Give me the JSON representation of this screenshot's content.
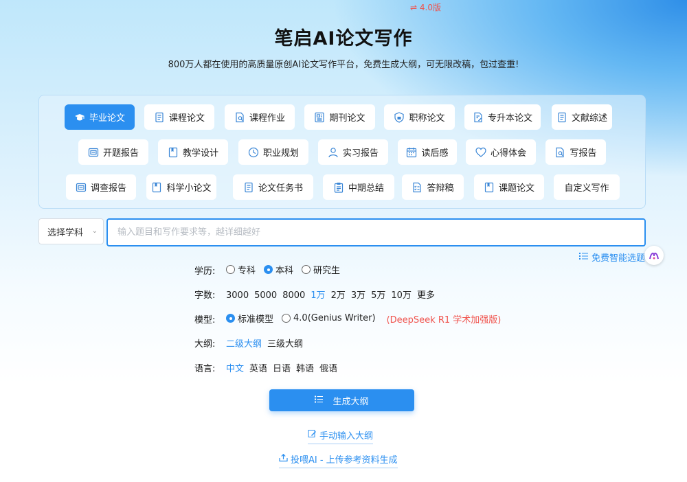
{
  "header": {
    "title": "笔启AI论文写作",
    "version": "⇌ 4.0版",
    "subtitle": "800万人都在使用的高质量原创AI论文写作平台，免费生成大纲，可无限改稿，包过查重!"
  },
  "paper_types": [
    {
      "label": "毕业论文",
      "icon": "graduation-cap-icon",
      "active": true
    },
    {
      "label": "课程论文",
      "icon": "document-icon"
    },
    {
      "label": "课程作业",
      "icon": "document-search-icon"
    },
    {
      "label": "期刊论文",
      "icon": "journal-icon"
    },
    {
      "label": "职称论文",
      "icon": "shield-badge-icon"
    },
    {
      "label": "专升本论文",
      "icon": "document-edit-icon"
    },
    {
      "label": "文献综述",
      "icon": "document-icon"
    },
    {
      "label": "开题报告",
      "icon": "report-icon"
    },
    {
      "label": "教学设计",
      "icon": "book-icon"
    },
    {
      "label": "职业规划",
      "icon": "clock-icon"
    },
    {
      "label": "实习报告",
      "icon": "person-icon"
    },
    {
      "label": "读后感",
      "icon": "calendar-icon"
    },
    {
      "label": "心得体会",
      "icon": "heart-icon"
    },
    {
      "label": "写报告",
      "icon": "document-search-icon"
    },
    {
      "label": "调查报告",
      "icon": "report-icon"
    },
    {
      "label": "科学小论文",
      "icon": "book-icon"
    },
    {
      "label": "论文任务书",
      "icon": "document-icon"
    },
    {
      "label": "中期总结",
      "icon": "clipboard-icon"
    },
    {
      "label": "答辩稿",
      "icon": "checklist-icon"
    },
    {
      "label": "课题论文",
      "icon": "book-icon"
    },
    {
      "label": "自定义写作",
      "icon": ""
    }
  ],
  "subject_select": {
    "label": "选择学科"
  },
  "topic_input": {
    "placeholder": "输入题目和写作要求等，越详细越好",
    "value": ""
  },
  "smart_topic": {
    "label": "免费智能选题"
  },
  "options": {
    "education": {
      "label": "学历:",
      "choices": [
        "专科",
        "本科",
        "研究生"
      ],
      "selected": "本科"
    },
    "word_count": {
      "label": "字数:",
      "choices": [
        "3000",
        "5000",
        "8000",
        "1万",
        "2万",
        "3万",
        "5万",
        "10万",
        "更多"
      ],
      "selected": "1万"
    },
    "model": {
      "label": "模型:",
      "choices": [
        "标准模型",
        "4.0(Genius Writer)"
      ],
      "selected": "标准模型",
      "note": "(DeepSeek R1 学术加强版)"
    },
    "outline": {
      "label": "大纲:",
      "choices": [
        "二级大纲",
        "三级大纲"
      ],
      "selected": "二级大纲"
    },
    "language": {
      "label": "语言:",
      "choices": [
        "中文",
        "英语",
        "日语",
        "韩语",
        "俄语"
      ],
      "selected": "中文"
    }
  },
  "actions": {
    "generate": "生成大纲",
    "manual_outline": "手动输入大纲",
    "upload": "投喂AI - 上传参考资料生成"
  },
  "colors": {
    "accent": "#2b8ff0",
    "warning": "#f0524c"
  }
}
